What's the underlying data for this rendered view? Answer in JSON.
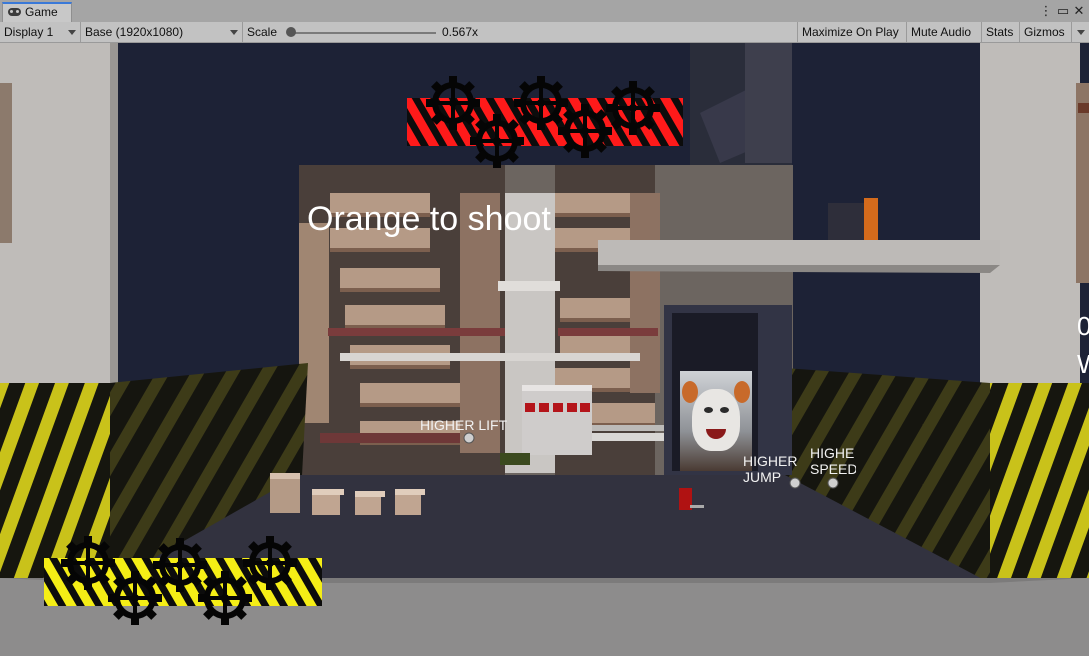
{
  "editor": {
    "tab_label": "Game",
    "tab_icon": "gamepad-icon",
    "menu_icon": "kebab-menu-icon",
    "maximize_icon": "maximize-icon",
    "close_icon": "close-icon"
  },
  "toolbar": {
    "display_label": "Display 1",
    "resolution_label": "Base (1920x1080)",
    "scale_label": "Scale",
    "scale_value": "0.567x",
    "scale_fraction": 0.02,
    "maximize_on_play_label": "Maximize On Play",
    "mute_audio_label": "Mute Audio",
    "stats_label": "Stats",
    "gizmos_label": "Gizmos"
  },
  "game": {
    "instruction_text": "Orange to shoot",
    "pickups": [
      {
        "label": "HIGHER LIFT"
      },
      {
        "label_line1": "HIGHER",
        "label_line2": "JUMP"
      },
      {
        "label_line1": "HIGHE",
        "label_line2": "SPEED"
      }
    ],
    "edge_text_top": "0",
    "edge_text_bottom": "W",
    "colors": {
      "hazard_red": "#ff1a1a",
      "hazard_yellow": "#f5ee16",
      "hud_text": "#ffffff"
    }
  }
}
